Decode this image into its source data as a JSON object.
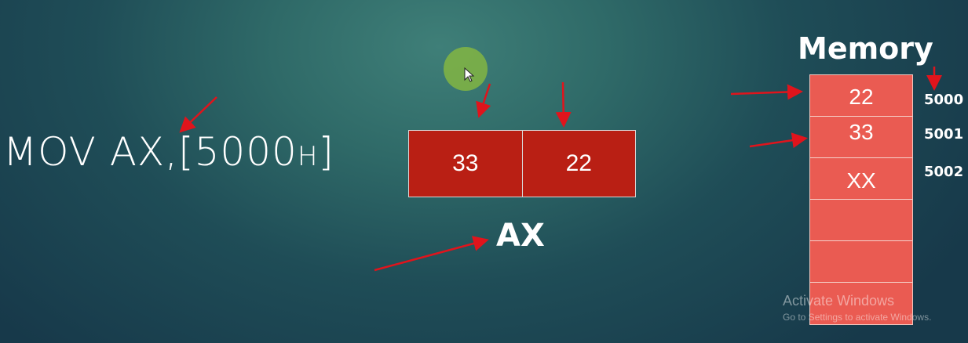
{
  "instruction": {
    "main": "MOV AX,[5000",
    "suffix": "H",
    "close": "]"
  },
  "register": {
    "name": "AX",
    "high_byte": "33",
    "low_byte": "22"
  },
  "memory": {
    "title": "Memory",
    "cells": [
      "22",
      "33",
      "XX",
      "",
      "",
      ""
    ],
    "addresses": [
      "5000",
      "5001",
      "5002"
    ]
  },
  "watermark": {
    "line1": "Activate Windows",
    "line2": "Go to Settings to activate Windows."
  },
  "colors": {
    "register_cell": "#b91f14",
    "memory_cell": "#ea5b52",
    "annotation_arrow": "#e0141c",
    "pointer_highlight": "#8cbe3c"
  },
  "icons": {
    "cursor": "mouse-pointer-icon"
  }
}
